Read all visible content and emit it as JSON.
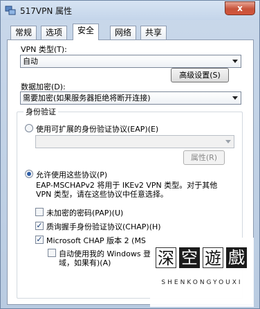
{
  "window": {
    "title": "517VPN 属性",
    "close_glyph": "x"
  },
  "tabs": [
    {
      "label": "常规"
    },
    {
      "label": "选项"
    },
    {
      "label": "安全",
      "active": true
    },
    {
      "label": "网络"
    },
    {
      "label": "共享"
    }
  ],
  "security": {
    "vpn_type_label": "VPN 类型(T):",
    "vpn_type_value": "自动",
    "advanced_button": "高级设置(S)",
    "encryption_label": "数据加密(D):",
    "encryption_value": "需要加密(如果服务器拒绝将断开连接)",
    "auth_group_title": "身份验证",
    "eap_radio_label": "使用可扩展的身份验证协议(EAP)(E)",
    "eap_combo_value": "",
    "properties_button": "属性(R)",
    "allow_protocols_label": "允许使用这些协议(P)",
    "protocols_note_line1": "EAP-MSCHAPv2 将用于 IKEv2 VPN 类型。对于其他",
    "protocols_note_line2": "VPN 类型，请在这些协议中任意选择。",
    "options": [
      {
        "label": "未加密的密码(PAP)(U)",
        "checked": false
      },
      {
        "label": "质询握手身份验证协议(CHAP)(H)",
        "checked": true
      },
      {
        "label": "Microsoft CHAP 版本 2 (MS",
        "checked": true
      }
    ],
    "auto_windows_line1": "自动使用我的 Windows 登",
    "auto_windows_line2": "域，如果有)(A)",
    "auto_windows_checked": false
  },
  "watermark": {
    "chars": [
      "深",
      "空",
      "遊",
      "戲"
    ],
    "text": "SHENKONGYOUXI"
  },
  "colors": {
    "window_frame": "#c9d8ea",
    "close_button": "#c7533b",
    "radio_dot": "#2f5fa8"
  }
}
